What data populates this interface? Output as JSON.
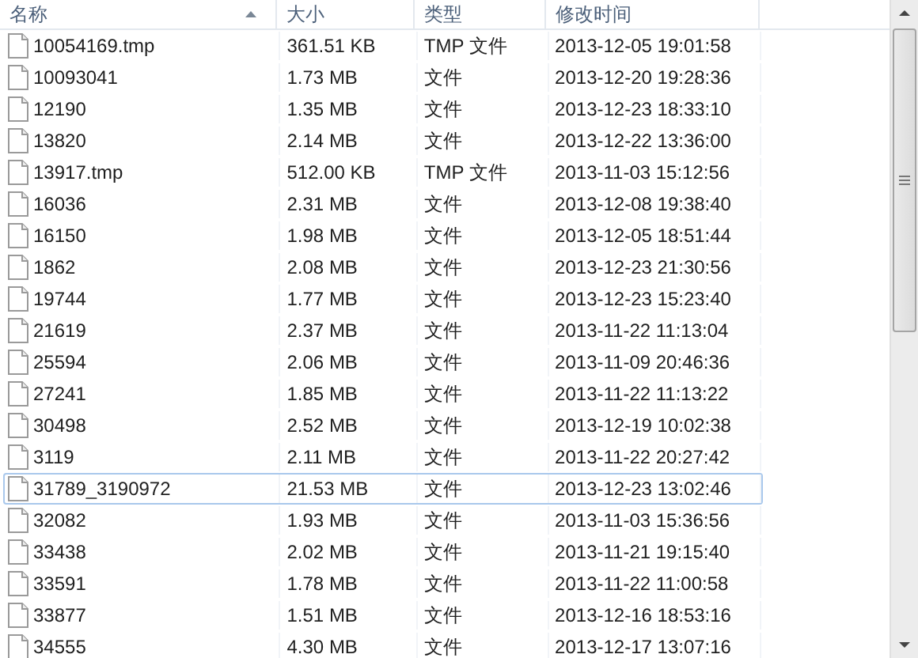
{
  "columns": [
    {
      "label": "名称",
      "sorted": true
    },
    {
      "label": "大小",
      "sorted": false
    },
    {
      "label": "类型",
      "sorted": false
    },
    {
      "label": "修改时间",
      "sorted": false
    }
  ],
  "rows": [
    {
      "name": "10054169.tmp",
      "size": "361.51 KB",
      "type": "TMP 文件",
      "modified": "2013-12-05 19:01:58",
      "focused": false
    },
    {
      "name": "10093041",
      "size": "1.73 MB",
      "type": "文件",
      "modified": "2013-12-20 19:28:36",
      "focused": false
    },
    {
      "name": "12190",
      "size": "1.35 MB",
      "type": "文件",
      "modified": "2013-12-23 18:33:10",
      "focused": false
    },
    {
      "name": "13820",
      "size": "2.14 MB",
      "type": "文件",
      "modified": "2013-12-22 13:36:00",
      "focused": false
    },
    {
      "name": "13917.tmp",
      "size": "512.00 KB",
      "type": "TMP 文件",
      "modified": "2013-11-03 15:12:56",
      "focused": false
    },
    {
      "name": "16036",
      "size": "2.31 MB",
      "type": "文件",
      "modified": "2013-12-08 19:38:40",
      "focused": false
    },
    {
      "name": "16150",
      "size": "1.98 MB",
      "type": "文件",
      "modified": "2013-12-05 18:51:44",
      "focused": false
    },
    {
      "name": "1862",
      "size": "2.08 MB",
      "type": "文件",
      "modified": "2013-12-23 21:30:56",
      "focused": false
    },
    {
      "name": "19744",
      "size": "1.77 MB",
      "type": "文件",
      "modified": "2013-12-23 15:23:40",
      "focused": false
    },
    {
      "name": "21619",
      "size": "2.37 MB",
      "type": "文件",
      "modified": "2013-11-22 11:13:04",
      "focused": false
    },
    {
      "name": "25594",
      "size": "2.06 MB",
      "type": "文件",
      "modified": "2013-11-09 20:46:36",
      "focused": false
    },
    {
      "name": "27241",
      "size": "1.85 MB",
      "type": "文件",
      "modified": "2013-11-22 11:13:22",
      "focused": false
    },
    {
      "name": "30498",
      "size": "2.52 MB",
      "type": "文件",
      "modified": "2013-12-19 10:02:38",
      "focused": false
    },
    {
      "name": "3119",
      "size": "2.11 MB",
      "type": "文件",
      "modified": "2013-11-22 20:27:42",
      "focused": false
    },
    {
      "name": "31789_3190972",
      "size": "21.53 MB",
      "type": "文件",
      "modified": "2013-12-23 13:02:46",
      "focused": true
    },
    {
      "name": "32082",
      "size": "1.93 MB",
      "type": "文件",
      "modified": "2013-11-03 15:36:56",
      "focused": false
    },
    {
      "name": "33438",
      "size": "2.02 MB",
      "type": "文件",
      "modified": "2013-11-21 19:15:40",
      "focused": false
    },
    {
      "name": "33591",
      "size": "1.78 MB",
      "type": "文件",
      "modified": "2013-11-22 11:00:58",
      "focused": false
    },
    {
      "name": "33877",
      "size": "1.51 MB",
      "type": "文件",
      "modified": "2013-12-16 18:53:16",
      "focused": false
    },
    {
      "name": "34555",
      "size": "4.30 MB",
      "type": "文件",
      "modified": "2013-12-17 13:07:16",
      "focused": false
    }
  ]
}
